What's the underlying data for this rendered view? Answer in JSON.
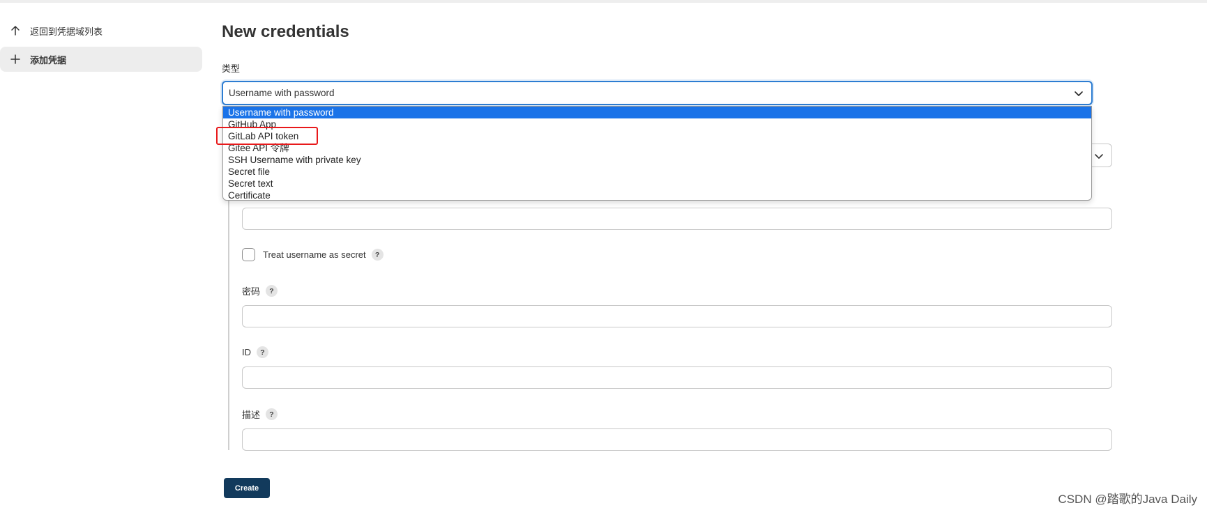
{
  "sidebar": {
    "items": [
      {
        "label": "返回到凭据域列表",
        "icon": "arrow-up-icon",
        "active": false
      },
      {
        "label": "添加凭据",
        "icon": "plus-icon",
        "active": true
      }
    ]
  },
  "main": {
    "title": "New credentials",
    "type_label": "类型",
    "type_select": {
      "value": "Username with password",
      "options": [
        "Username with password",
        "GitHub App",
        "GitLab API token",
        "Gitee API 令牌",
        "SSH Username with private key",
        "Secret file",
        "Secret text",
        "Certificate"
      ],
      "highlighted_option": "GitLab API token"
    },
    "treat_username_label": "Treat username as secret",
    "password_label": "密码",
    "id_label": "ID",
    "description_label": "描述",
    "help_symbol": "?",
    "create_button": "Create"
  },
  "watermark": "CSDN @踏歌的Java Daily",
  "colors": {
    "accent": "#2d7dd2",
    "selected_option": "#1a73e8",
    "highlight_box": "#e8191b",
    "button": "#123a5c"
  }
}
